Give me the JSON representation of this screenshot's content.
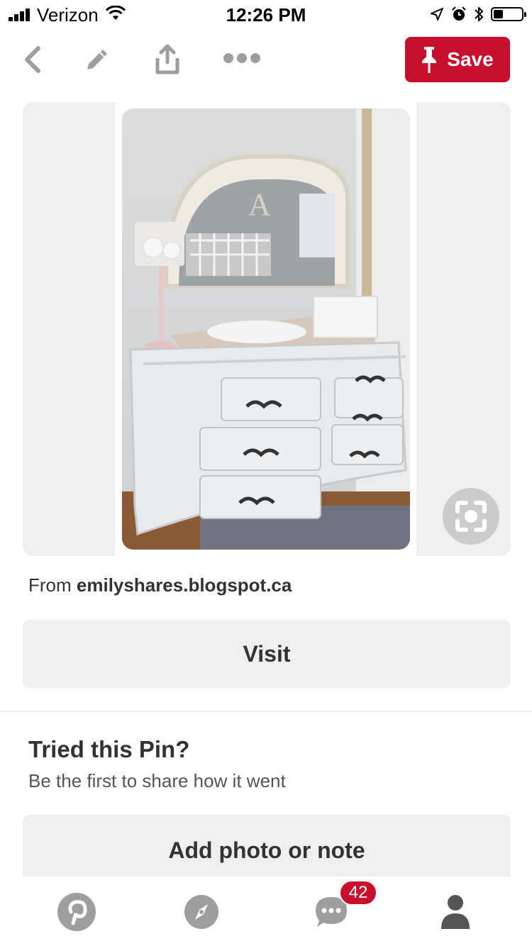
{
  "status_bar": {
    "carrier": "Verizon",
    "time": "12:26 PM",
    "battery_level": 0.35
  },
  "toolbar": {
    "save_label": "Save"
  },
  "pin": {
    "source_prefix": "From",
    "source_domain": "emilyshares.blogspot.ca",
    "visit_label": "Visit"
  },
  "tried": {
    "title": "Tried this Pin?",
    "subtitle": "Be the first to share how it went",
    "add_label": "Add photo or note"
  },
  "tabbar": {
    "notifications_count": "42"
  },
  "colors": {
    "brand_red": "#c8102e",
    "card_gray": "#efefef",
    "icon_gray": "#9e9e9e"
  }
}
